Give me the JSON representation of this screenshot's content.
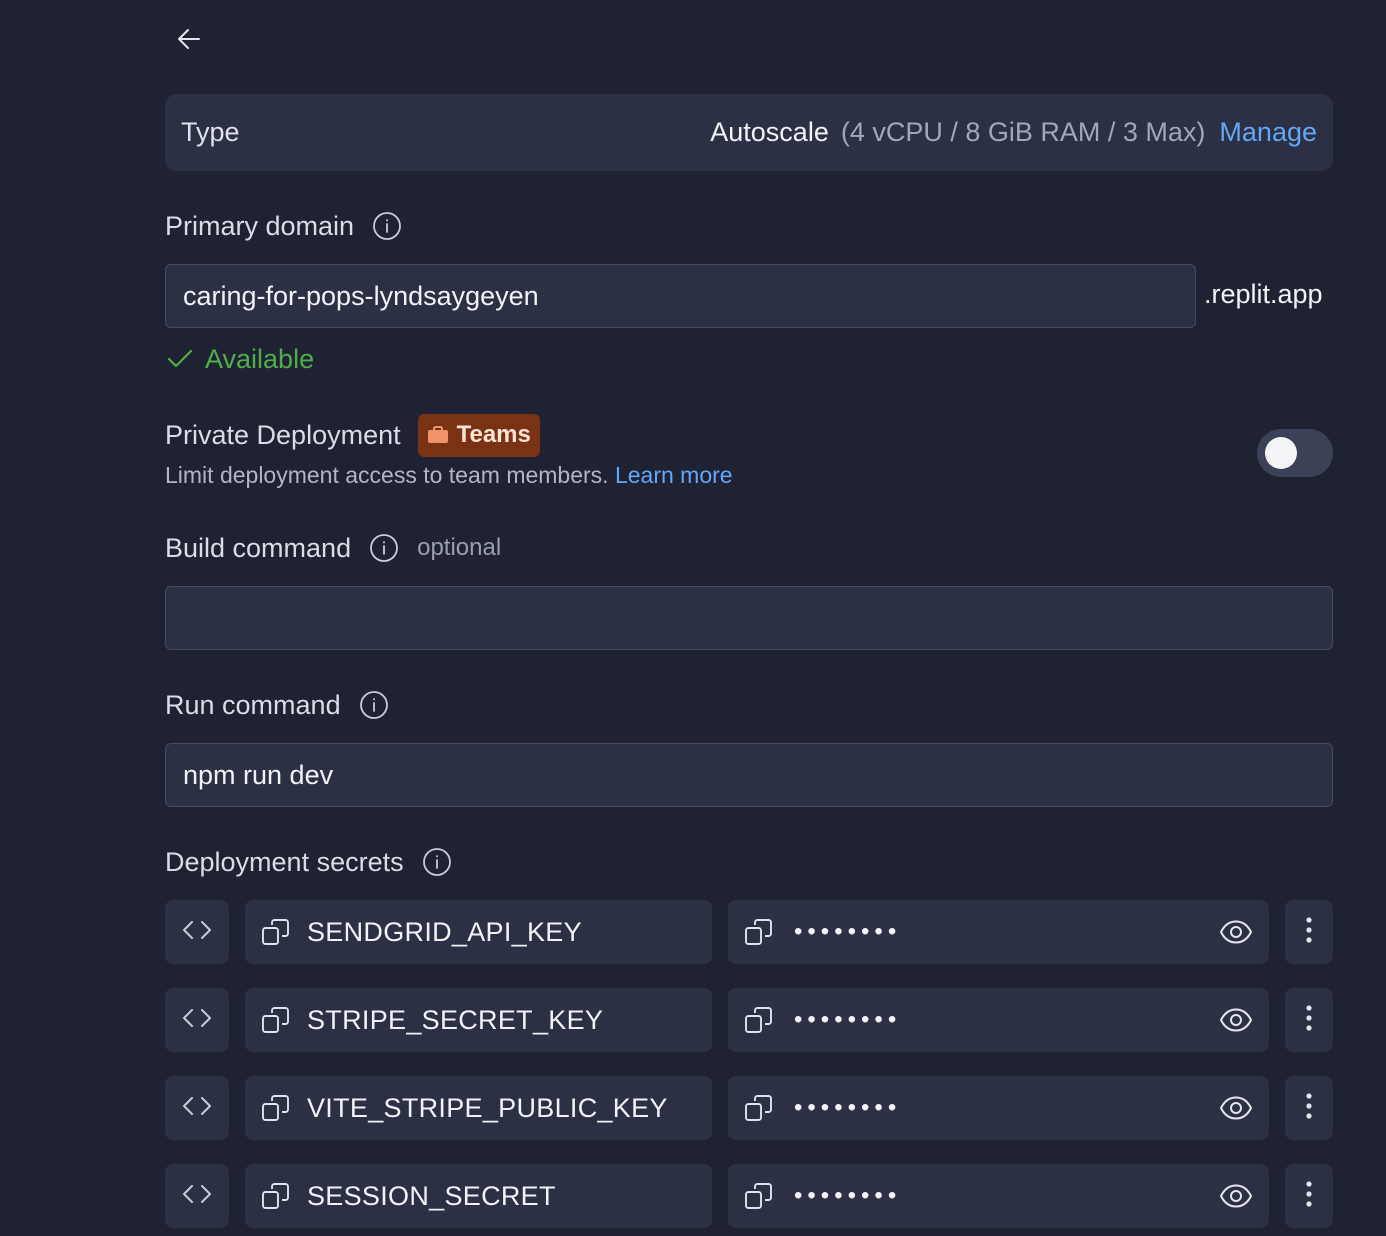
{
  "type_section": {
    "label": "Type",
    "value": "Autoscale",
    "detail": "(4 vCPU / 8 GiB RAM / 3 Max)",
    "manage_label": "Manage"
  },
  "primary_domain": {
    "label": "Primary domain",
    "value": "caring-for-pops-lyndsaygeyen",
    "suffix": ".replit.app",
    "status": "Available"
  },
  "private_deployment": {
    "label": "Private Deployment",
    "badge": "Teams",
    "description": "Limit deployment access to team members.",
    "learn_more": "Learn more",
    "enabled": false
  },
  "build_command": {
    "label": "Build command",
    "optional_label": "optional",
    "value": ""
  },
  "run_command": {
    "label": "Run command",
    "value": "npm run dev"
  },
  "secrets": {
    "label": "Deployment secrets",
    "items": [
      {
        "key": "SENDGRID_API_KEY",
        "masked": "••••••••"
      },
      {
        "key": "STRIPE_SECRET_KEY",
        "masked": "••••••••"
      },
      {
        "key": "VITE_STRIPE_PUBLIC_KEY",
        "masked": "••••••••"
      },
      {
        "key": "SESSION_SECRET",
        "masked": "••••••••"
      }
    ]
  },
  "colors": {
    "background": "#1e2233",
    "surface": "#2b3044",
    "link": "#63a7f5",
    "success": "#4fae4a",
    "badge": "#7a3214"
  }
}
